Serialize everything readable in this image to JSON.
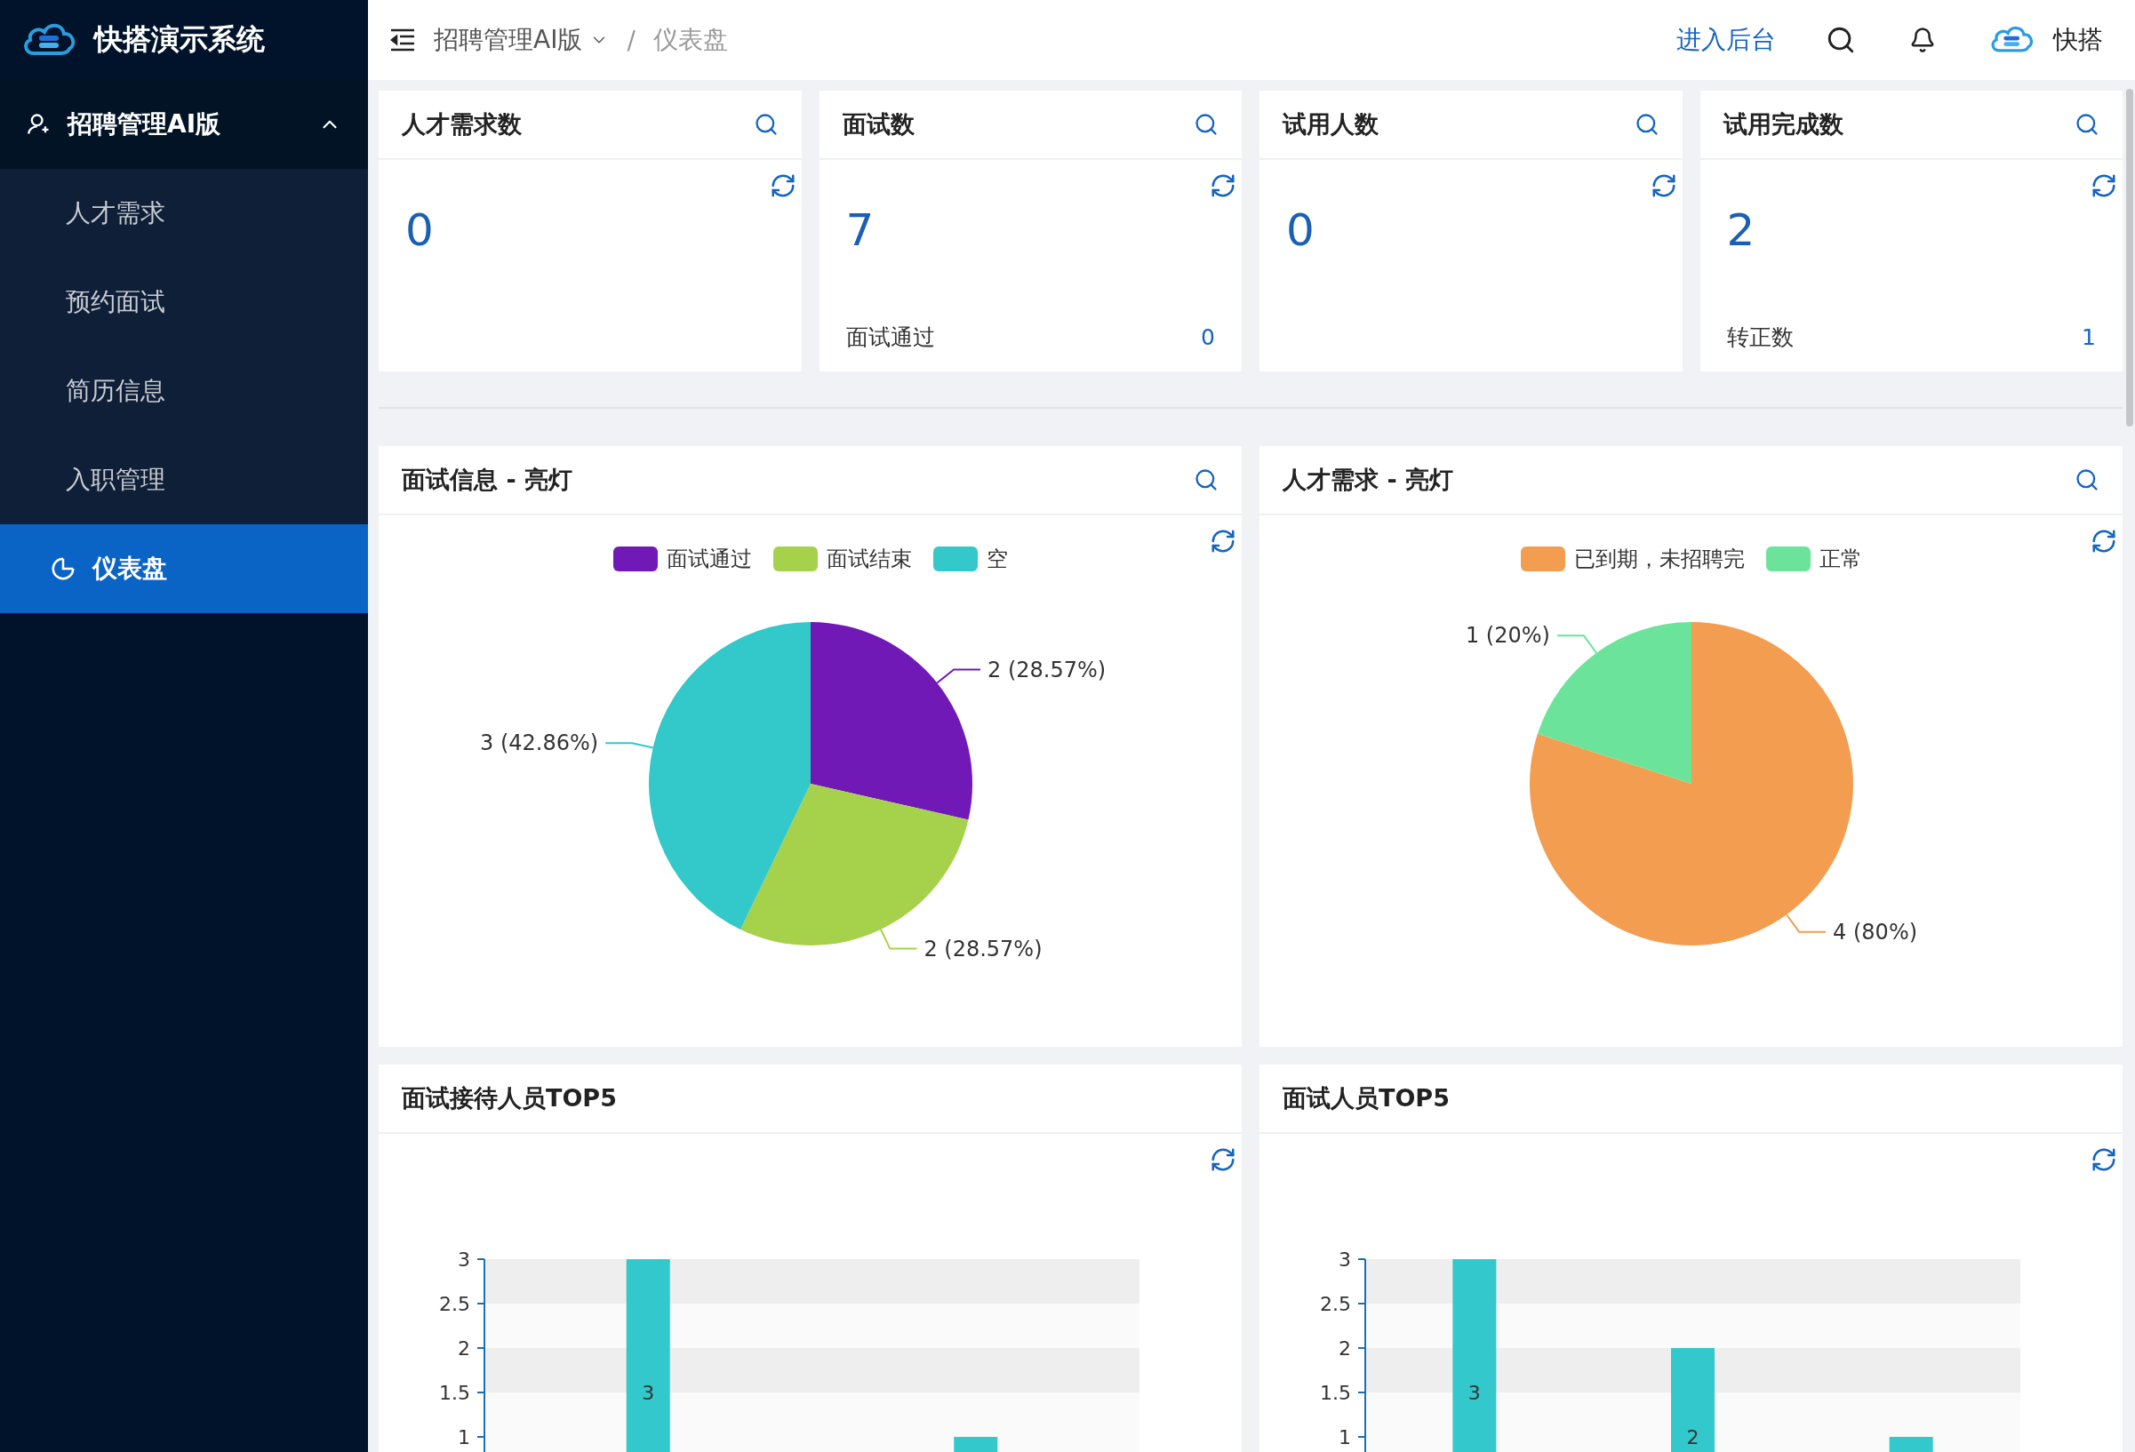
{
  "brand": {
    "name": "快搭演示系统"
  },
  "sidebar": {
    "group": {
      "label": "招聘管理AI版",
      "expanded": true
    },
    "items": [
      {
        "label": "人才需求",
        "kind": "link",
        "selected": false
      },
      {
        "label": "预约面试",
        "kind": "link",
        "selected": false
      },
      {
        "label": "简历信息",
        "kind": "link",
        "selected": false
      },
      {
        "label": "入职管理",
        "kind": "link",
        "selected": false
      },
      {
        "label": "仪表盘",
        "kind": "chart",
        "selected": true
      }
    ]
  },
  "header": {
    "separator": "/",
    "breadcrumb": [
      {
        "label": "招聘管理AI版",
        "dropdown": true
      },
      {
        "label": "仪表盘",
        "dropdown": false
      }
    ],
    "admin_link": "进入后台",
    "user": "快搭"
  },
  "stat_cards": [
    {
      "title": "人才需求数",
      "value": "0"
    },
    {
      "title": "面试数",
      "value": "7",
      "footer": {
        "label": "面试通过",
        "value": "0"
      }
    },
    {
      "title": "试用人数",
      "value": "0"
    },
    {
      "title": "试用完成数",
      "value": "2",
      "footer": {
        "label": "转正数",
        "value": "1"
      }
    }
  ],
  "pie_cards": [
    {
      "title": "面试信息 - 亮灯",
      "chart_data": {
        "type": "pie",
        "legend": "top",
        "categories": [
          "面试通过",
          "面试结束",
          "空"
        ],
        "values": [
          2,
          2,
          3
        ],
        "colors": [
          "#7019b6",
          "#a6d14b",
          "#33c8c9"
        ],
        "value_labels": [
          "2 (28.57%)",
          "2 (28.57%)",
          "3 (42.86%)"
        ]
      }
    },
    {
      "title": "人才需求 - 亮灯",
      "chart_data": {
        "type": "pie",
        "legend": "top",
        "categories": [
          "已到期，未招聘完",
          "正常"
        ],
        "values": [
          4,
          1
        ],
        "colors": [
          "#f29d50",
          "#6ce39b"
        ],
        "value_labels": [
          "4 (80%)",
          "1 (20%)"
        ]
      }
    }
  ],
  "bar_cards": [
    {
      "title": "面试接待人员TOP5",
      "chart_data": {
        "type": "bar",
        "categories": [
          null,
          null
        ],
        "series": [
          {
            "color": "#33c8cb",
            "values": [
              3,
              1
            ]
          }
        ],
        "ylim": [
          0,
          3
        ],
        "yticks": [
          1,
          1.5,
          2,
          2.5,
          3
        ],
        "value_labels": [
          "3",
          null
        ]
      }
    },
    {
      "title": "面试人员TOP5",
      "chart_data": {
        "type": "bar",
        "categories": [
          null,
          null,
          null
        ],
        "series": [
          {
            "color": "#33c8cb",
            "values": [
              3,
              2,
              1
            ]
          }
        ],
        "ylim": [
          0,
          3
        ],
        "yticks": [
          1,
          1.5,
          2,
          2.5,
          3
        ],
        "value_labels": [
          "3",
          "2",
          null
        ]
      }
    }
  ]
}
